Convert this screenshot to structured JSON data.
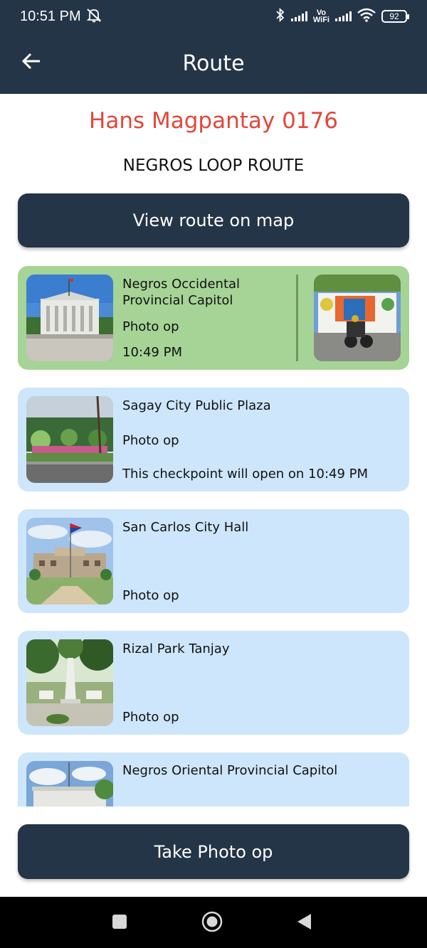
{
  "status_bar": {
    "time": "10:51 PM",
    "vowifi_top": "Vo",
    "vowifi_bottom": "WiFi",
    "battery": "92",
    "icons": [
      "mute-icon",
      "bluetooth-icon",
      "signal-icon",
      "wifi-icon",
      "battery-icon"
    ]
  },
  "app_bar": {
    "title": "Route",
    "back_icon": "arrow-left-icon"
  },
  "header": {
    "rider": "Hans Magpantay 0176",
    "route": "NEGROS LOOP ROUTE"
  },
  "buttons": {
    "view_map": "View route on map",
    "take_photo": "Take Photo op"
  },
  "checkpoints": [
    {
      "name": "Negros Occidental Provincial Capitol",
      "type": "Photo op",
      "status": "10:49 PM",
      "completed": true
    },
    {
      "name": "Sagay City Public Plaza",
      "type": "Photo op",
      "status": "This checkpoint will open on 10:49 PM",
      "completed": false
    },
    {
      "name": "San Carlos City Hall",
      "type": "Photo op",
      "status": "",
      "completed": false
    },
    {
      "name": "Rizal Park Tanjay",
      "type": "Photo op",
      "status": "",
      "completed": false
    },
    {
      "name": "Negros Oriental Provincial Capitol",
      "type": "",
      "status": "",
      "completed": false
    }
  ],
  "nav_bar": {
    "icons": [
      "recents-icon",
      "home-icon",
      "back-icon"
    ]
  },
  "colors": {
    "primary": "#253548",
    "accent": "#e2473a",
    "completed_card": "#a6d496",
    "pending_card": "#cde6fb"
  }
}
